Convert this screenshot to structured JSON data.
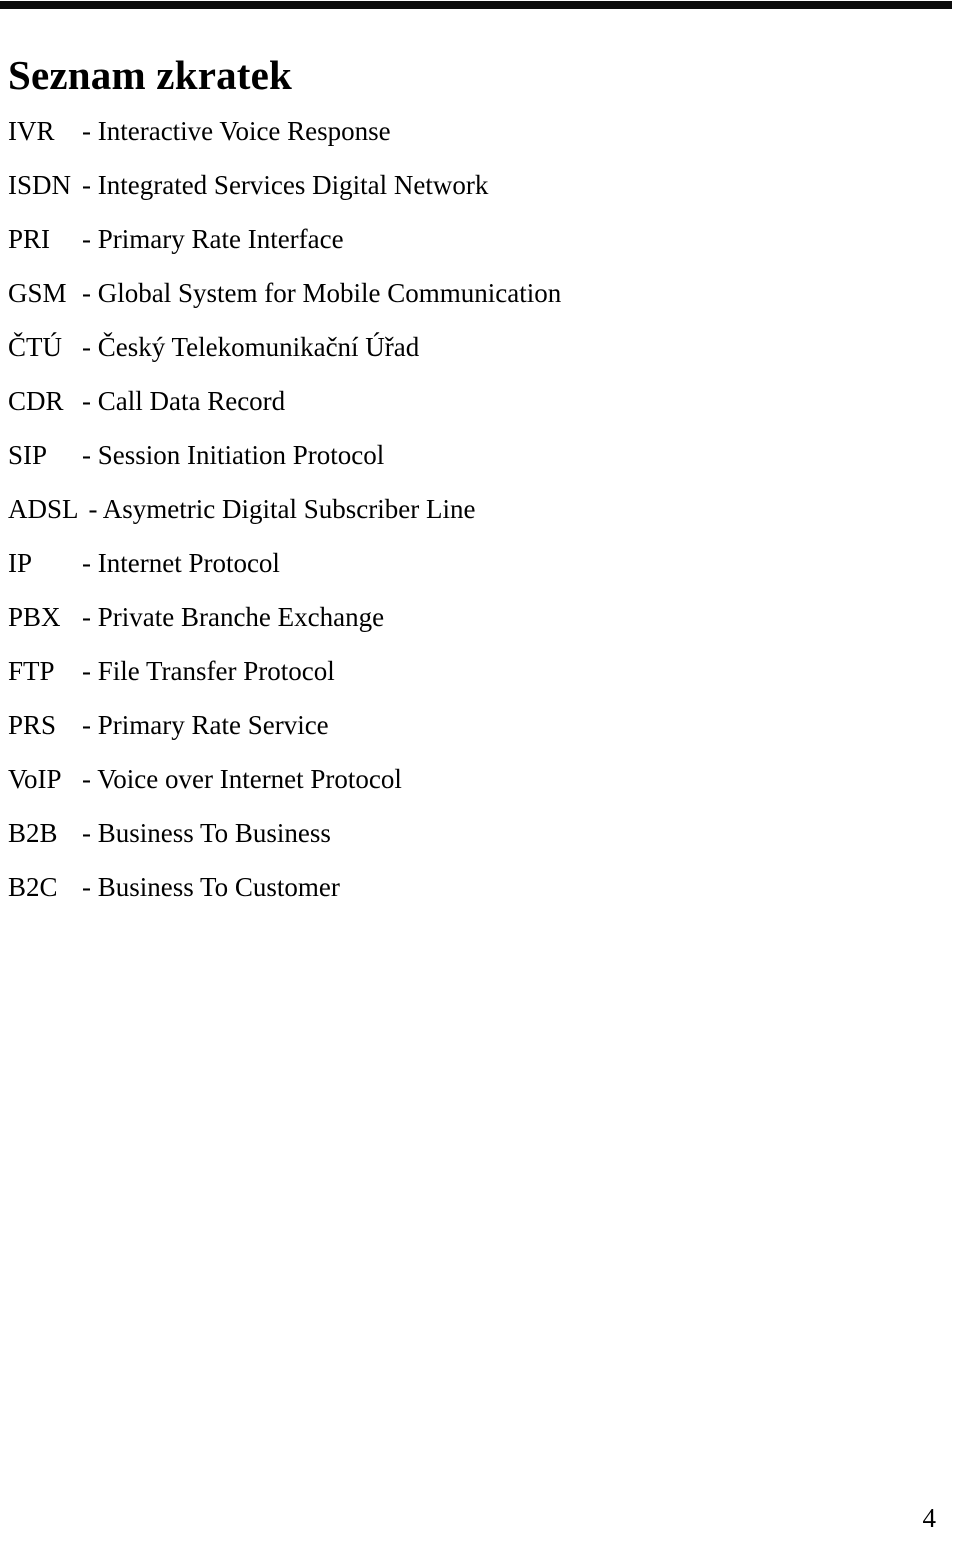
{
  "document": {
    "title": "Seznam zkratek",
    "page_number": "4",
    "rule_color": "#0b0b0b"
  },
  "abbreviations": [
    {
      "term": "IVR",
      "definition": "- Interactive Voice Response"
    },
    {
      "term": "ISDN",
      "definition": "- Integrated Services Digital Network"
    },
    {
      "term": "PRI",
      "definition": "- Primary Rate Interface"
    },
    {
      "term": "GSM",
      "definition": "- Global System for Mobile Communication"
    },
    {
      "term": "ČTÚ",
      "definition": "- Český Telekomunikační Úřad"
    },
    {
      "term": "CDR",
      "definition": "- Call Data Record"
    },
    {
      "term": "SIP",
      "definition": "- Session Initiation Protocol"
    },
    {
      "term": "ADSL",
      "definition": "- Asymetric Digital Subscriber Line"
    },
    {
      "term": "IP",
      "definition": "- Internet Protocol"
    },
    {
      "term": "PBX",
      "definition": "- Private Branche Exchange"
    },
    {
      "term": "FTP",
      "definition": "- File Transfer Protocol"
    },
    {
      "term": "PRS",
      "definition": "- Primary Rate Service"
    },
    {
      "term": "VoIP",
      "definition": "- Voice over Internet Protocol"
    },
    {
      "term": "B2B",
      "definition": "- Business To Business"
    },
    {
      "term": "B2C",
      "definition": "- Business To Customer"
    }
  ]
}
